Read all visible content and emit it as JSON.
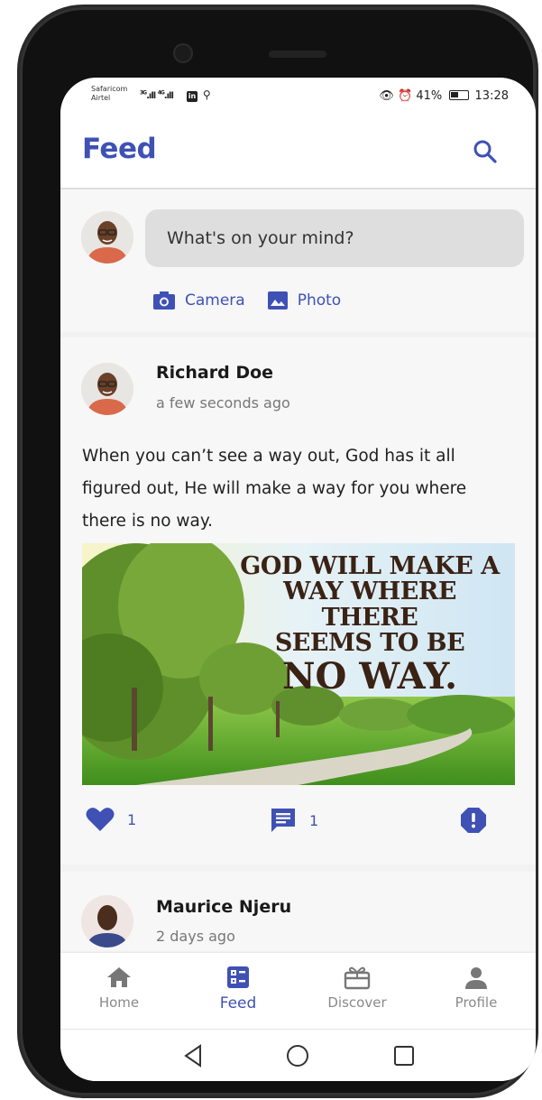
{
  "status_bar": {
    "carrier_1": "Safaricom",
    "carrier_2": "Airtel",
    "signal_1": "3G",
    "signal_2": "4G",
    "battery": "41%",
    "time": "13:28"
  },
  "app_bar": {
    "title": "Feed",
    "search_icon": "search-icon"
  },
  "composer": {
    "placeholder": "What's on your mind?",
    "camera_label": "Camera",
    "photo_label": "Photo"
  },
  "posts": [
    {
      "author": "Richard Doe",
      "time": "a few seconds ago",
      "text": "When you can’t see a way out, God has it all figured out, He will make a way for you where there is no way.",
      "image_text": {
        "line1": "GOD WILL MAKE A",
        "line2": "WAY WHERE THERE",
        "line3": "SEEMS TO BE",
        "line4": "NO WAY."
      },
      "likes": "1",
      "comments": "1"
    },
    {
      "author": "Maurice Njeru",
      "time": "2 days ago"
    }
  ],
  "bottom_nav": [
    {
      "label": "Home",
      "icon": "home-icon"
    },
    {
      "label": "Feed",
      "icon": "feed-icon"
    },
    {
      "label": "Discover",
      "icon": "gift-icon"
    },
    {
      "label": "Profile",
      "icon": "person-icon"
    }
  ],
  "colors": {
    "primary": "#3f51b5",
    "inactive": "#8a8a8a"
  }
}
